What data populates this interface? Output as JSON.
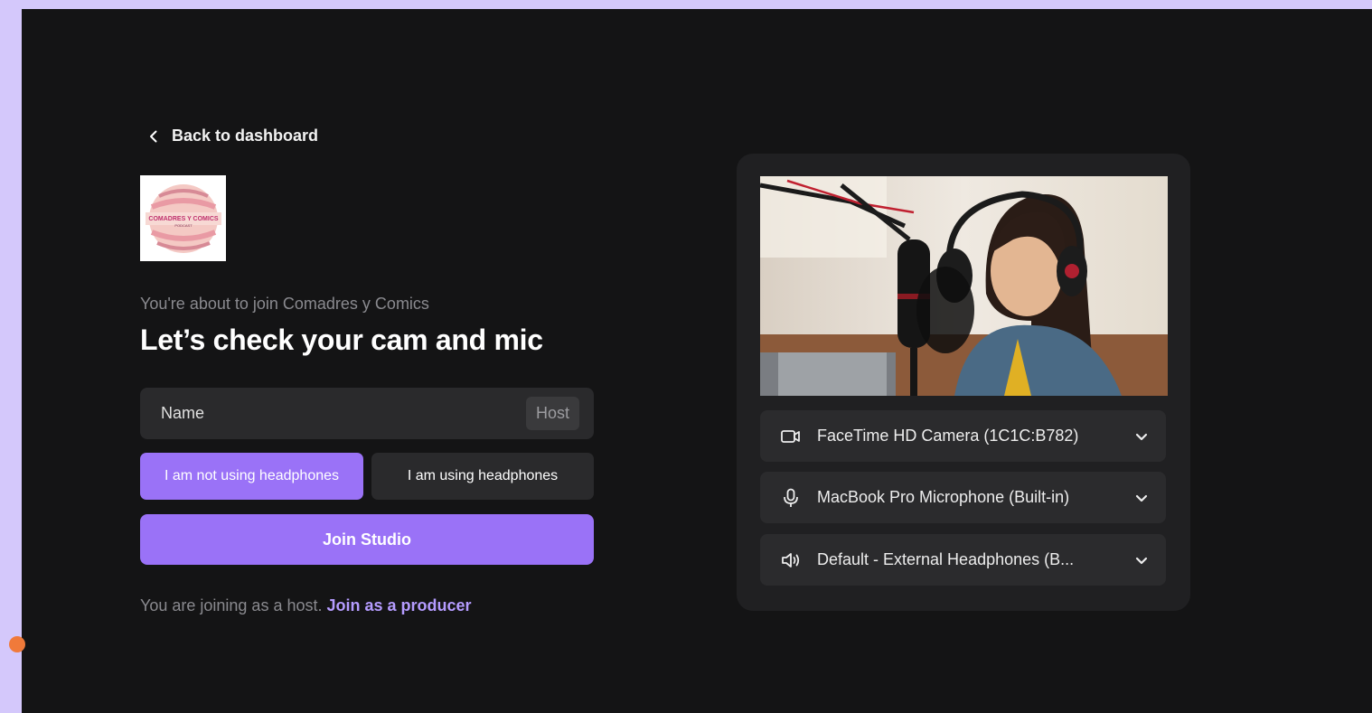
{
  "nav": {
    "back_label": "Back to dashboard"
  },
  "show": {
    "logo_text": "COMADRES Y COMICS",
    "logo_subtext": "PODCAST"
  },
  "intro": {
    "subtitle": "You're about to join Comadres y Comics",
    "title": "Let’s check your cam and mic"
  },
  "form": {
    "name_placeholder": "Name",
    "role_badge": "Host",
    "headphones_off_label": "I am not using headphones",
    "headphones_on_label": "I am using headphones",
    "headphones_selected": "not_using",
    "join_label": "Join Studio"
  },
  "footer": {
    "joining_text": "You are joining as a host.",
    "producer_link": "Join as a producer"
  },
  "devices": {
    "camera": {
      "label": "FaceTime HD Camera (1C1C:B782)",
      "icon": "video-camera-icon"
    },
    "microphone": {
      "label": "MacBook Pro Microphone (Built-in)",
      "icon": "microphone-icon"
    },
    "speaker": {
      "label": "Default - External Headphones (B...",
      "icon": "speaker-icon"
    }
  },
  "colors": {
    "accent": "#9a72f7",
    "link": "#b59cff",
    "background": "#141415",
    "outer": "#d4c8fb"
  }
}
